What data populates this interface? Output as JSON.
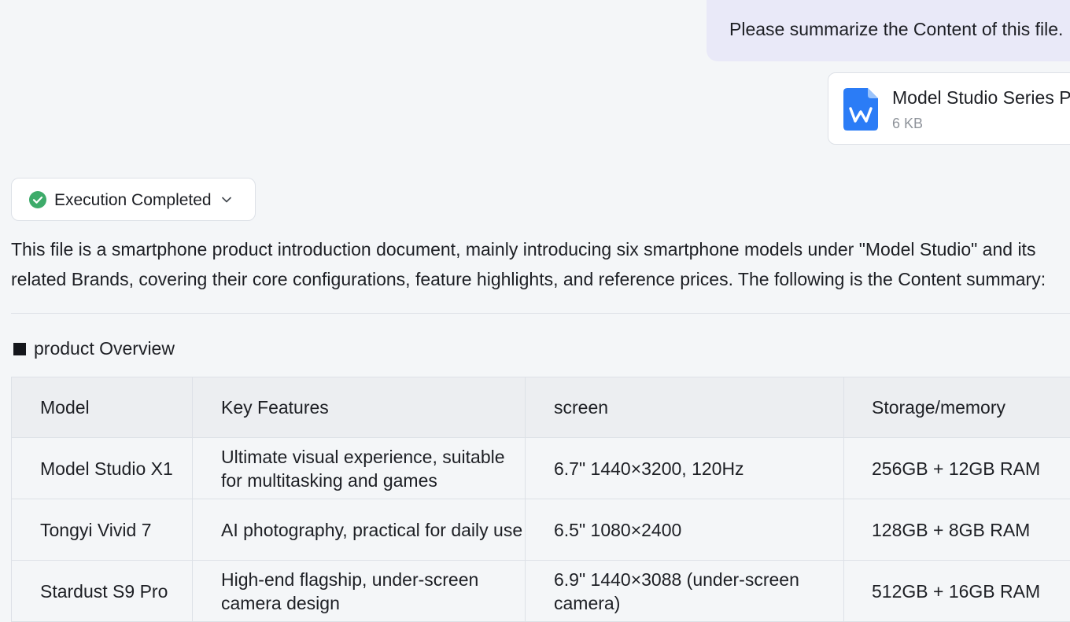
{
  "conversation": {
    "user_message": "Please summarize the Content of this file.",
    "attachment": {
      "name": "Model Studio Series Ph",
      "size": "6 KB",
      "icon": "word-document-icon",
      "icon_color": "#2b7cf6"
    }
  },
  "response": {
    "status": {
      "label": "Execution Completed",
      "icon": "check-circle-icon",
      "icon_color": "#3dab6a",
      "expand_icon": "chevron-down-icon"
    },
    "summary": "This file is a smartphone product introduction document, mainly introducing six smartphone models under \"Model Studio\" and its related Brands, covering their core configurations, feature highlights, and reference prices. The following is the Content summary:",
    "section_heading": "product Overview",
    "table": {
      "headers": [
        "Model",
        "Key Features",
        "screen",
        "Storage/memory"
      ],
      "rows": [
        [
          "Model Studio X1",
          "Ultimate visual experience, suitable for multitasking and games",
          "6.7\" 1440×3200, 120Hz",
          "256GB + 12GB RAM"
        ],
        [
          "Tongyi Vivid 7",
          "AI photography, practical for daily use",
          "6.5\" 1080×2400",
          "128GB + 8GB RAM"
        ],
        [
          "Stardust S9 Pro",
          "High-end flagship, under-screen camera design",
          "6.9\" 1440×3088  (under-screen camera)",
          "512GB + 16GB RAM"
        ]
      ]
    }
  }
}
